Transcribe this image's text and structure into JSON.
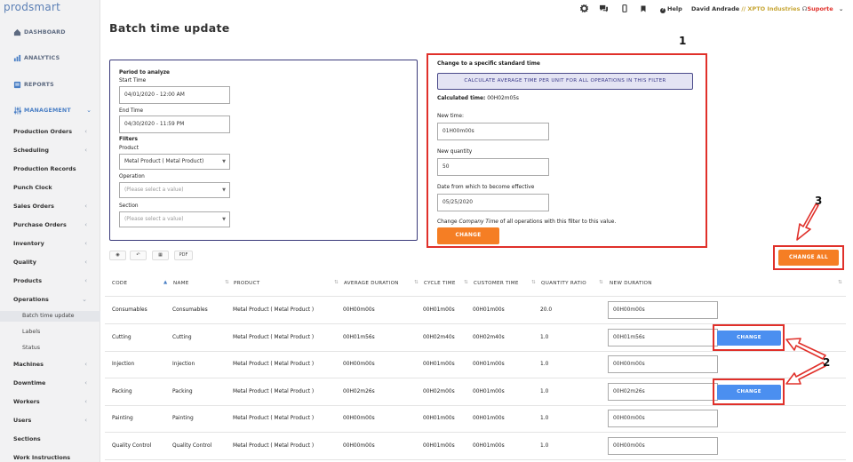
{
  "brand": "prodsmart",
  "sidebar": {
    "main": [
      {
        "label": "DASHBOARD"
      },
      {
        "label": "ANALYTICS"
      },
      {
        "label": "REPORTS"
      },
      {
        "label": "MANAGEMENT"
      }
    ],
    "items": [
      {
        "label": "Production Orders"
      },
      {
        "label": "Scheduling"
      },
      {
        "label": "Production Records"
      },
      {
        "label": "Punch Clock"
      },
      {
        "label": "Sales Orders"
      },
      {
        "label": "Purchase Orders"
      },
      {
        "label": "Inventory"
      },
      {
        "label": "Quality"
      },
      {
        "label": "Products"
      },
      {
        "label": "Operations"
      }
    ],
    "sub": [
      {
        "label": "Batch time update"
      },
      {
        "label": "Labels"
      },
      {
        "label": "Status"
      }
    ],
    "items2": [
      {
        "label": "Machines"
      },
      {
        "label": "Downtime"
      },
      {
        "label": "Workers"
      },
      {
        "label": "Users"
      },
      {
        "label": "Sections"
      },
      {
        "label": "Work Instructions"
      }
    ]
  },
  "topbar": {
    "help": "Help",
    "user": "David Andrade",
    "sep": "//",
    "company": "XPTO Industries",
    "support": "Suporte"
  },
  "page_title": "Batch time update",
  "filters": {
    "period_title": "Period to analyze",
    "start_label": "Start Time",
    "start_value": "04/01/2020 - 12:00 AM",
    "end_label": "End Time",
    "end_value": "04/30/2020 - 11:59 PM",
    "filters_title": "Filters",
    "product_label": "Product",
    "product_value": "Metal Product ( Metal Product)",
    "operation_label": "Operation",
    "operation_placeholder": "(Please select a value)",
    "section_label": "Section",
    "section_placeholder": "(Please select a value)"
  },
  "change_panel": {
    "title": "Change to a specific standard time",
    "calc_button": "CALCULATE AVERAGE TIME PER UNIT FOR ALL OPERATIONS IN THIS FILTER",
    "calculated_label": "Calculated time:",
    "calculated_value": "00H02m05s",
    "new_time_label": "New time:",
    "new_time_value": "01H00m00s",
    "new_qty_label": "New quantity",
    "new_qty_value": "50",
    "date_label": "Date from which to become effective",
    "date_value": "05/25/2020",
    "note_pre": "Change ",
    "note_em": "Company Time",
    "note_post": " of all operations with this filter to this value.",
    "change_button": "CHANGE"
  },
  "change_all_button": "CHANGE ALL",
  "toolbar": {
    "pdf": "PDF"
  },
  "table": {
    "headers": [
      "CODE",
      "NAME",
      "PRODUCT",
      "AVERAGE DURATION",
      "CYCLE TIME",
      "CUSTOMER TIME",
      "QUANTITY RATIO",
      "NEW DURATION"
    ],
    "rows": [
      {
        "code": "Consumables",
        "name": "Consumables",
        "product": "Metal Product ( Metal Product )",
        "avg": "00H00m00s",
        "cycle": "00H01m00s",
        "customer": "00H01m00s",
        "ratio": "20.0",
        "new": "00H00m00s",
        "button": ""
      },
      {
        "code": "Cutting",
        "name": "Cutting",
        "product": "Metal Product ( Metal Product )",
        "avg": "00H01m56s",
        "cycle": "00H02m40s",
        "customer": "00H02m40s",
        "ratio": "1.0",
        "new": "00H01m56s",
        "button": "CHANGE"
      },
      {
        "code": "Injection",
        "name": "Injection",
        "product": "Metal Product ( Metal Product )",
        "avg": "00H00m00s",
        "cycle": "00H01m00s",
        "customer": "00H01m00s",
        "ratio": "1.0",
        "new": "00H00m00s",
        "button": ""
      },
      {
        "code": "Packing",
        "name": "Packing",
        "product": "Metal Product ( Metal Product )",
        "avg": "00H02m26s",
        "cycle": "00H02m00s",
        "customer": "00H01m00s",
        "ratio": "1.0",
        "new": "00H02m26s",
        "button": "CHANGE"
      },
      {
        "code": "Painting",
        "name": "Painting",
        "product": "Metal Product ( Metal Product )",
        "avg": "00H00m00s",
        "cycle": "00H01m00s",
        "customer": "00H01m00s",
        "ratio": "1.0",
        "new": "00H00m00s",
        "button": ""
      },
      {
        "code": "Quality Control",
        "name": "Quality Control",
        "product": "Metal Product ( Metal Product )",
        "avg": "00H00m00s",
        "cycle": "00H01m00s",
        "customer": "00H01m00s",
        "ratio": "1.0",
        "new": "00H00m00s",
        "button": ""
      }
    ]
  },
  "annotations": {
    "a1": "1",
    "a2": "2",
    "a3": "3"
  },
  "colors": {
    "accent_orange": "#f57e24",
    "accent_blue": "#4b8ff0",
    "annotation_red": "#e0302a"
  }
}
